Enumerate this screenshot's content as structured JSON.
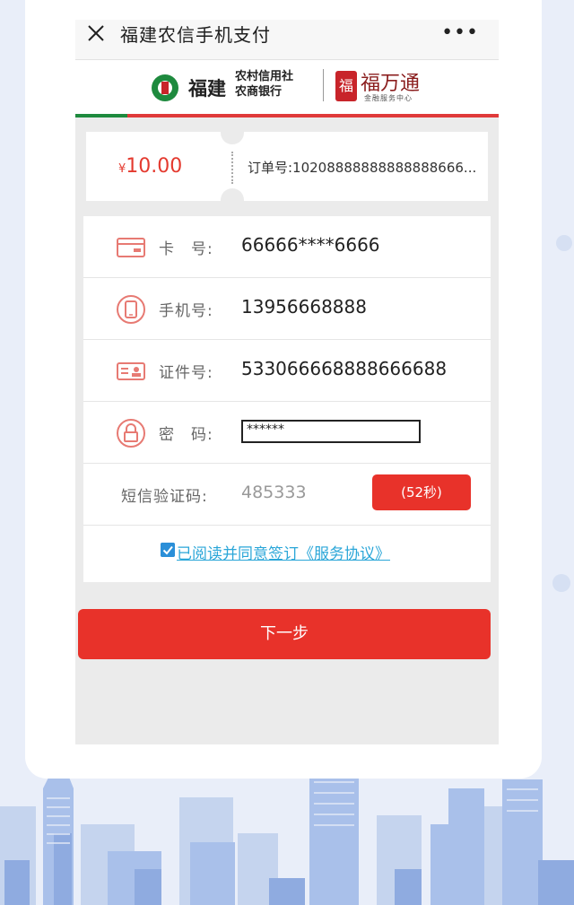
{
  "title_bar": {
    "title": "福建农信手机支付",
    "more_label": "•••"
  },
  "brand": {
    "bank_name": "福建",
    "bank_sub_line1": "农村信用社",
    "bank_sub_line2": "农商银行",
    "service_seal": "福",
    "service_name": "福万通",
    "service_sub": "金融服务中心"
  },
  "order": {
    "currency": "¥",
    "amount": "10.00",
    "order_number": "订单号:10208888888888888666..."
  },
  "form": {
    "card": {
      "label": "卡　号:",
      "value": "66666****6666"
    },
    "phone": {
      "label": "手机号:",
      "value": "13956668888"
    },
    "id": {
      "label": "证件号:",
      "value": "533066668888666688"
    },
    "password": {
      "label": "密　码:",
      "value": "******"
    },
    "sms": {
      "label": "短信验证码:",
      "value": "485333",
      "countdown": "(52秒)"
    },
    "agreement": {
      "text": "已阅读并同意签订《服务协议》",
      "checked": true
    }
  },
  "next_button": "下一步",
  "colors": {
    "accent_red": "#e8322a",
    "link_blue": "#2aa6d8",
    "brand_green": "#1e8a3e",
    "icon_red": "#e77a73"
  }
}
